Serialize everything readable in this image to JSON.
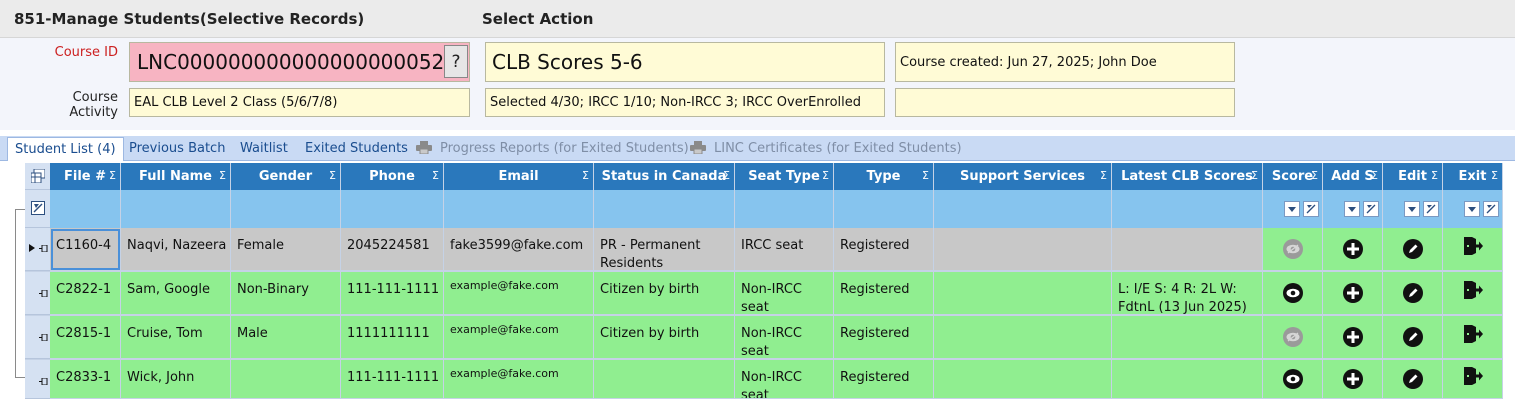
{
  "window": {
    "title": "851-Manage Students(Selective Records)",
    "action_title": "Select Action"
  },
  "form": {
    "course_id_label": "Course ID",
    "course_id_value": "LNC000000000000000000052",
    "lookup_label": "?",
    "course_activity_label": "Course Activity",
    "course_activity_value": "EAL CLB Level 2 Class (5/6/7/8)",
    "action_value": "CLB Scores 5-6",
    "status_value": "Selected 4/30; IRCC 1/10; Non-IRCC 3; IRCC OverEnrolled",
    "created_value": "Course created: Jun 27, 2025;  John Doe",
    "blank_value": ""
  },
  "tabs": [
    {
      "label": "Student List (4)"
    },
    {
      "label": "Previous Batch"
    },
    {
      "label": "Waitlist"
    },
    {
      "label": "Exited Students"
    },
    {
      "label": "Progress Reports (for Exited Students)"
    },
    {
      "label": "LINC Certificates (for Exited Students)"
    }
  ],
  "grid": {
    "sigma": "Σ",
    "columns": [
      "File #",
      "Full Name",
      "Gender",
      "Phone",
      "Email",
      "Status in Canada",
      "Seat Type",
      "Type",
      "Support Services",
      "Latest CLB Scores",
      "Score",
      "Add S",
      "Edit",
      "Exit"
    ],
    "rows": [
      {
        "file": "C1160-4",
        "name": "Naqvi, Nazeera",
        "gender": "Female",
        "phone": "2045224581",
        "email": "fake3599@fake.com",
        "status": "PR - Permanent Residents",
        "seat": "IRCC seat",
        "type": "Registered",
        "support": "",
        "clb": "",
        "score_state": "disabled"
      },
      {
        "file": "C2822-1",
        "name": "Sam, Google",
        "gender": "Non-Binary",
        "phone": "111-111-1111",
        "email": "example@fake.com",
        "status": "Citizen by birth",
        "seat": "Non-IRCC seat",
        "type": "Registered",
        "support": "",
        "clb": "L: I/E S: 4 R: 2L W: FdtnL (13 Jun 2025)",
        "score_state": "enabled"
      },
      {
        "file": "C2815-1",
        "name": "Cruise, Tom",
        "gender": "Male",
        "phone": "1111111111",
        "email": "example@fake.com",
        "status": "Citizen by birth",
        "seat": "Non-IRCC seat",
        "type": "Registered",
        "support": "",
        "clb": "",
        "score_state": "disabled"
      },
      {
        "file": "C2833-1",
        "name": "Wick, John",
        "gender": "",
        "phone": "111-111-1111",
        "email": "example@fake.com",
        "status": "",
        "seat": "Non-IRCC seat",
        "type": "Registered",
        "support": "",
        "clb": "",
        "score_state": "enabled"
      }
    ]
  },
  "colors": {
    "header_bg": "#2a78bc",
    "filter_bg": "#86c4ee",
    "row_selected": "#c8c8c8",
    "row_bg": "#90ee90",
    "input_bg": "#fffbd6",
    "course_id_bg": "#f7b4c2"
  }
}
